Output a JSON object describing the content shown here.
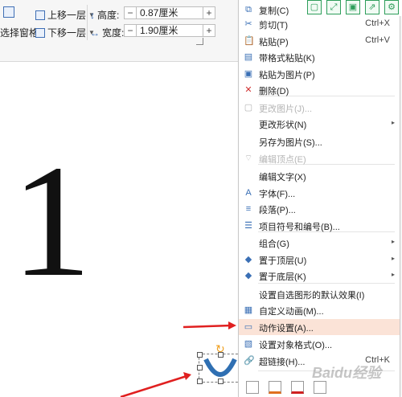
{
  "ribbon": {
    "selection_pane_label": "选择窗格",
    "bring_forward_label": "上移一层",
    "send_backward_label": "下移一层",
    "height_label": "高度:",
    "height_value": "0.87厘米",
    "width_label": "宽度:",
    "width_value": "1.90厘米",
    "minus": "−",
    "plus": "+"
  },
  "slide": {
    "big_text": "1"
  },
  "context_menu": {
    "items": [
      {
        "label": "复制(C)",
        "shortcut": "",
        "icon": "copy-icon",
        "glyph": "⧉",
        "disabled": false
      },
      {
        "label": "剪切(T)",
        "shortcut": "Ctrl+X",
        "icon": "scissors-icon",
        "glyph": "✂",
        "disabled": false
      },
      {
        "label": "粘贴(P)",
        "shortcut": "Ctrl+V",
        "icon": "paste-icon",
        "glyph": "📋",
        "disabled": false
      },
      {
        "label": "带格式粘贴(K)",
        "shortcut": "",
        "icon": "paste-format-icon",
        "glyph": "▤",
        "disabled": false
      },
      {
        "label": "粘贴为图片(P)",
        "shortcut": "",
        "icon": "paste-image-icon",
        "glyph": "▣",
        "disabled": false
      },
      {
        "label": "删除(D)",
        "shortcut": "",
        "icon": "delete-icon",
        "glyph": "✕",
        "disabled": false
      },
      {
        "label": "更改图片(J)...",
        "shortcut": "",
        "icon": "change-image-icon",
        "glyph": "▢",
        "disabled": true
      },
      {
        "label": "更改形状(N)",
        "shortcut": "",
        "icon": "",
        "glyph": "",
        "disabled": false,
        "submenu": true
      },
      {
        "label": "另存为图片(S)...",
        "shortcut": "",
        "icon": "",
        "glyph": "",
        "disabled": false
      },
      {
        "label": "编辑顶点(E)",
        "shortcut": "",
        "icon": "edit-points-icon",
        "glyph": "⌔",
        "disabled": true
      },
      {
        "label": "编辑文字(X)",
        "shortcut": "",
        "icon": "",
        "glyph": "",
        "disabled": false
      },
      {
        "label": "字体(F)...",
        "shortcut": "",
        "icon": "font-icon",
        "glyph": "A",
        "disabled": false
      },
      {
        "label": "段落(P)...",
        "shortcut": "",
        "icon": "paragraph-icon",
        "glyph": "≡",
        "disabled": false
      },
      {
        "label": "项目符号和编号(B)...",
        "shortcut": "",
        "icon": "bullets-icon",
        "glyph": "☰",
        "disabled": false
      },
      {
        "label": "组合(G)",
        "shortcut": "",
        "icon": "",
        "glyph": "",
        "disabled": false,
        "submenu": true
      },
      {
        "label": "置于顶层(U)",
        "shortcut": "",
        "icon": "bring-to-front-icon",
        "glyph": "◆",
        "disabled": false,
        "submenu": true
      },
      {
        "label": "置于底层(K)",
        "shortcut": "",
        "icon": "send-to-back-icon",
        "glyph": "◆",
        "disabled": false,
        "submenu": true
      },
      {
        "label": "设置自选图形的默认效果(I)",
        "shortcut": "",
        "icon": "",
        "glyph": "",
        "disabled": false
      },
      {
        "label": "自定义动画(M)...",
        "shortcut": "",
        "icon": "animation-icon",
        "glyph": "▦",
        "disabled": false
      },
      {
        "label": "动作设置(A)...",
        "shortcut": "",
        "icon": "action-settings-icon",
        "glyph": "▭",
        "disabled": false,
        "highlighted": true
      },
      {
        "label": "设置对象格式(O)...",
        "shortcut": "",
        "icon": "format-object-icon",
        "glyph": "▧",
        "disabled": false
      },
      {
        "label": "超链接(H)...",
        "shortcut": "Ctrl+K",
        "icon": "hyperlink-icon",
        "glyph": "🔗",
        "disabled": false
      }
    ]
  },
  "colors": {
    "highlight": "#fbe3d7",
    "arrow": "#e02020",
    "accent_green": "#2e9e5b"
  },
  "watermark": "Baidu经验"
}
